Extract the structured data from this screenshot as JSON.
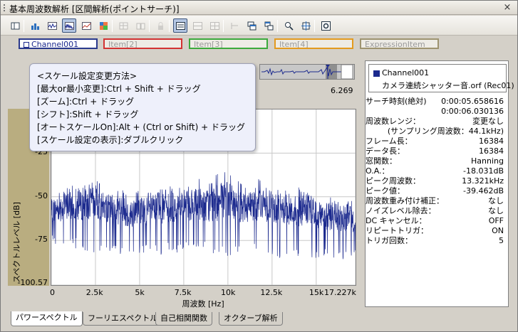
{
  "window": {
    "title": "基本周波数解析 [区間解析(ポイントサーチ)]",
    "close_glyph": "×"
  },
  "toolbar": {
    "buttons": [
      {
        "icon": "layout-icon",
        "active": false,
        "disabled": false
      },
      {
        "icon": "bar-chart-icon",
        "active": false,
        "disabled": false
      },
      {
        "icon": "wave-chart-icon",
        "active": false,
        "disabled": false
      },
      {
        "icon": "spectrum-chart-icon",
        "active": true,
        "disabled": false
      },
      {
        "icon": "line-chart-icon",
        "active": false,
        "disabled": false
      },
      {
        "icon": "color-map-icon",
        "active": false,
        "disabled": false
      },
      {
        "icon": "grid-chart-icon",
        "active": false,
        "disabled": true
      },
      {
        "icon": "compare-icon",
        "active": false,
        "disabled": true
      },
      {
        "icon": "lock-icon",
        "active": false,
        "disabled": true
      },
      {
        "icon": "single-view-icon",
        "active": true,
        "disabled": false
      },
      {
        "icon": "split-view-icon",
        "active": false,
        "disabled": true
      },
      {
        "icon": "tile-view-icon",
        "active": false,
        "disabled": true
      },
      {
        "icon": "cursor-icon",
        "active": false,
        "disabled": true
      },
      {
        "icon": "window-stack-icon",
        "active": false,
        "disabled": false
      },
      {
        "icon": "window-cascade-icon",
        "active": false,
        "disabled": false
      },
      {
        "icon": "zoom-icon",
        "active": false,
        "disabled": false
      },
      {
        "icon": "fit-icon",
        "active": false,
        "disabled": false
      },
      {
        "icon": "settings-icon",
        "active": false,
        "disabled": false
      }
    ]
  },
  "channels": [
    {
      "label": "Channel001",
      "color": "#2b3a8c",
      "selected": true
    },
    {
      "label": "Item[2]",
      "color": "#d23232",
      "selected": false
    },
    {
      "label": "Item[3]",
      "color": "#3caa3c",
      "selected": false
    },
    {
      "label": "Item[4]",
      "color": "#e39a1f",
      "selected": false
    },
    {
      "label": "ExpressionItem",
      "color": "#9e9470",
      "selected": false
    }
  ],
  "overview": {
    "time_label": "6.269"
  },
  "tooltip": {
    "lines": [
      "<スケール設定変更方法>",
      "[最大or最小変更]:Ctrl + Shift + ドラッグ",
      "[ズーム]:Ctrl + ドラッグ",
      "[シフト]:Shift + ドラッグ",
      "[オートスケールOn]:Alt + (Ctrl or Shift) + ドラッグ",
      "[スケール設定の表示]:ダブルクリック"
    ]
  },
  "chart_data": {
    "type": "line",
    "title": "",
    "xlabel": "周波数 [Hz]",
    "ylabel": "スペクトルレベル [dB]",
    "xlim": [
      0,
      17227
    ],
    "ylim": [
      -100.57,
      0
    ],
    "x_ticks": [
      0,
      2500,
      5000,
      7500,
      10000,
      12500,
      15000,
      17227
    ],
    "x_tick_labels": [
      "0",
      "2.5k",
      "5k",
      "7.5k",
      "10k",
      "12.5k",
      "15k",
      "17.227k"
    ],
    "y_ticks": [
      -25,
      -50,
      -75,
      -100.57
    ],
    "y_tick_labels": [
      "-25",
      "-50",
      "-75",
      "-100.57"
    ],
    "grid": true,
    "series": [
      {
        "name": "Channel001",
        "color": "#1c2a8e",
        "x": [
          0,
          500,
          1000,
          1500,
          2000,
          2500,
          3000,
          3500,
          4000,
          4500,
          5000,
          5500,
          6000,
          6500,
          7000,
          7500,
          8000,
          8500,
          9000,
          9500,
          10000,
          10500,
          11000,
          11500,
          12000,
          12500,
          13000,
          13500,
          14000,
          14500,
          15000,
          15500,
          16000,
          16500,
          17000
        ],
        "y_center": [
          -58,
          -56,
          -55,
          -56,
          -54,
          -54,
          -56,
          -57,
          -58,
          -60,
          -58,
          -58,
          -57,
          -57,
          -56,
          -55,
          -55,
          -54,
          -55,
          -53,
          -52,
          -55,
          -56,
          -54,
          -55,
          -56,
          -57,
          -58,
          -58,
          -58,
          -60,
          -61,
          -62,
          -62,
          -63
        ],
        "y_max": [
          -48,
          -44,
          -42,
          -44,
          -42,
          -40,
          -44,
          -46,
          -46,
          -48,
          -46,
          -44,
          -46,
          -44,
          -44,
          -44,
          -42,
          -38,
          -40,
          -34,
          -36,
          -40,
          -44,
          -38,
          -42,
          -44,
          -46,
          -46,
          -44,
          -46,
          -48,
          -50,
          -50,
          -50,
          -52
        ],
        "y_min": [
          -78,
          -80,
          -78,
          -80,
          -82,
          -82,
          -80,
          -82,
          -84,
          -84,
          -84,
          -82,
          -84,
          -82,
          -84,
          -80,
          -82,
          -80,
          -84,
          -82,
          -84,
          -84,
          -84,
          -80,
          -82,
          -84,
          -86,
          -84,
          -86,
          -84,
          -86,
          -86,
          -86,
          -86,
          -86
        ]
      }
    ]
  },
  "info": {
    "legend_channel": "Channel001",
    "legend_file": "カメラ連続シャッター音.orf (Rec01)",
    "legend_color": "#1c2a8e",
    "rows": [
      {
        "label": "サーチ時刻(絶対)",
        "value": "0:00:05.658616"
      },
      {
        "label": "",
        "value": "0:00:06.030136"
      },
      {
        "label": "周波数レンジ：",
        "value": "変更なし"
      },
      {
        "label": "",
        "value": "(サンプリング周波数：44.1kHz)"
      },
      {
        "label": "フレーム長：",
        "value": "16384"
      },
      {
        "label": "データ長：",
        "value": "16384"
      },
      {
        "label": "窓関数：",
        "value": "Hanning"
      },
      {
        "label": "O.A.：",
        "value": "-18.031dB"
      },
      {
        "label": "ピーク周波数：",
        "value": "13.321kHz"
      },
      {
        "label": "ピーク値：",
        "value": "-39.462dB"
      },
      {
        "label": "周波数重み付け補正：",
        "value": "なし"
      },
      {
        "label": "ノイズレベル除去：",
        "value": "なし"
      },
      {
        "label": "DC キャンセル：",
        "value": "OFF"
      },
      {
        "label": "リピートトリガ：",
        "value": "ON"
      },
      {
        "label": "トリガ回数：",
        "value": "5"
      }
    ]
  },
  "bottom_tabs": [
    {
      "label": "パワースペクトル",
      "active": true
    },
    {
      "label": "フーリエスペクトル",
      "active": false
    },
    {
      "label": "自己相関関数",
      "active": false
    },
    {
      "label": "オクターブ解析",
      "active": false
    }
  ]
}
